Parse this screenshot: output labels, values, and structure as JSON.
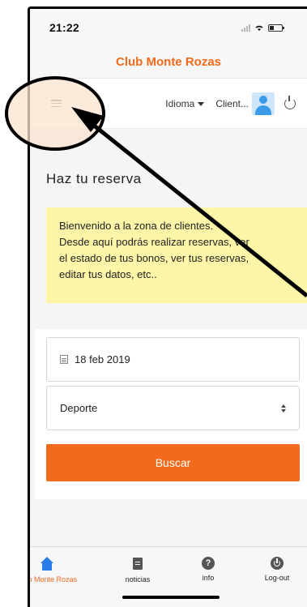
{
  "status_bar": {
    "time": "21:22"
  },
  "app": {
    "title": "Club Monte Rozas"
  },
  "navbar": {
    "language_label": "Idioma",
    "client_label": "Client..."
  },
  "page": {
    "title": "Haz tu reserva",
    "welcome_lines": [
      "Bienvenido a la zona de clientes.",
      "Desde aquí podrás realizar reservas, ver",
      "el estado de tus bonos, ver tus reservas,",
      "editar tus datos, etc.."
    ]
  },
  "form": {
    "date_value": "18 feb 2019",
    "sport_value": "Deporte",
    "search_label": "Buscar"
  },
  "tabs": [
    {
      "label": "Club Monte Rozas",
      "icon": "home-icon",
      "active": true
    },
    {
      "label": "noticias",
      "icon": "document-icon"
    },
    {
      "label": "info",
      "icon": "question-icon"
    },
    {
      "label": "Log-out",
      "icon": "power-icon"
    }
  ],
  "colors": {
    "brand_orange": "#f26b1d",
    "welcome_yellow": "#fdf6a8",
    "active_tab_blue": "#2b7de9",
    "annotation_highlight": "#fbe3cf"
  }
}
